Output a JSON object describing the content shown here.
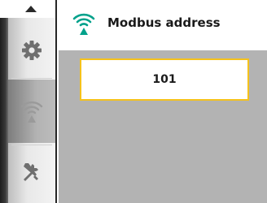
{
  "header": {
    "title": "Modbus address",
    "icon": "wifi-signal-icon",
    "icon_color": "#00a18b"
  },
  "field": {
    "value": "101",
    "focus_color": "#f5c21b"
  },
  "sidebar": {
    "scroll_up_icon": "chevron-up-icon",
    "items": [
      {
        "icon": "gear-icon",
        "selected": false
      },
      {
        "icon": "wifi-signal-icon",
        "selected": true
      },
      {
        "icon": "wrench-screwdriver-icon",
        "selected": false
      }
    ]
  },
  "colors": {
    "accent": "#00a18b",
    "content_background": "#b3b3b3",
    "focus_border": "#f5c21b"
  }
}
